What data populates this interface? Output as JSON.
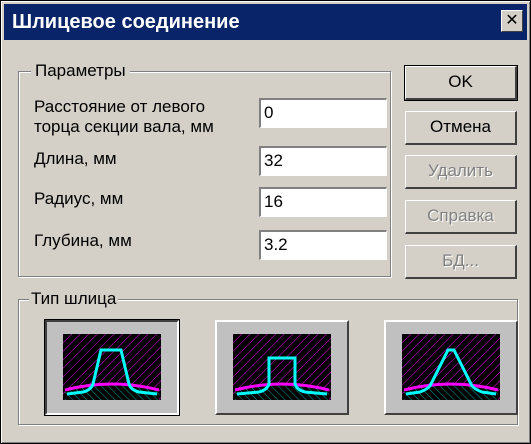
{
  "window": {
    "title": "Шлицевое соединение",
    "close_glyph": "✕"
  },
  "params": {
    "legend": "Параметры",
    "fields": [
      {
        "label": "Расстояние от левого\nторца секции вала, мм",
        "value": "0"
      },
      {
        "label": "Длина, мм",
        "value": "32"
      },
      {
        "label": "Радиус, мм",
        "value": "16"
      },
      {
        "label": "Глубина, мм",
        "value": "3.2"
      }
    ]
  },
  "buttons": {
    "ok": "OK",
    "cancel": "Отмена",
    "delete": "Удалить",
    "help": "Справка",
    "db": "БД..."
  },
  "spline_type": {
    "legend": "Тип шлица",
    "options": [
      {
        "name": "rectangular",
        "selected": true
      },
      {
        "name": "involute",
        "selected": false
      },
      {
        "name": "triangular",
        "selected": false
      }
    ]
  },
  "colors": {
    "titlebar": "#0a246a",
    "profile": "#00ffff",
    "shaft_line": "#ff00ff",
    "hatch": "#ff00ff",
    "icon_bg": "#000000"
  }
}
